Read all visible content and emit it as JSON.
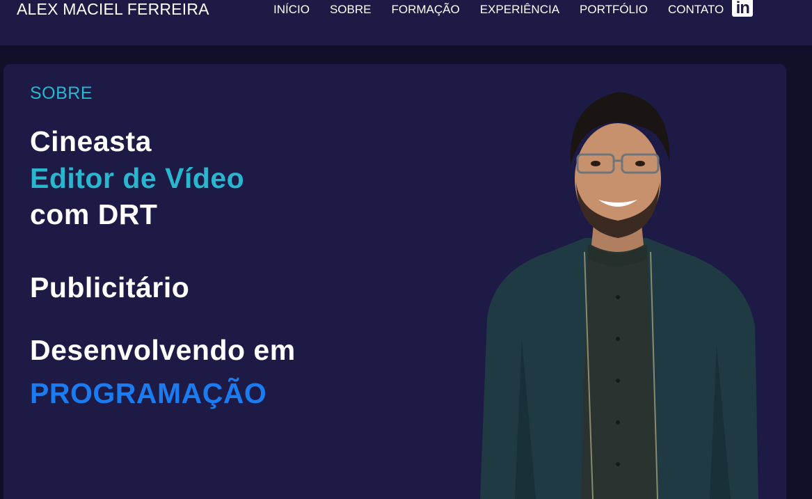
{
  "header": {
    "brand": "ALEX MACIEL FERREIRA",
    "nav": [
      "INÍCIO",
      "SOBRE",
      "FORMAÇÃO",
      "EXPERIÊNCIA",
      "PORTFÓLIO",
      "CONTATO"
    ],
    "linkedin_icon_text": "in"
  },
  "hero": {
    "section_label": "SOBRE",
    "line1": "Cineasta",
    "line2": "Editor de Vídeo",
    "line3": "com DRT",
    "line4": "Publicitário",
    "line5": "Desenvolvendo em",
    "line6": "PROGRAMAÇÃO",
    "photo_icon": "person-photo"
  },
  "colors": {
    "header_bg": "#1d1a45",
    "page_bg": "#120f2a",
    "accent_cyan": "#29b6cf",
    "accent_blue": "#1a7cf0"
  }
}
